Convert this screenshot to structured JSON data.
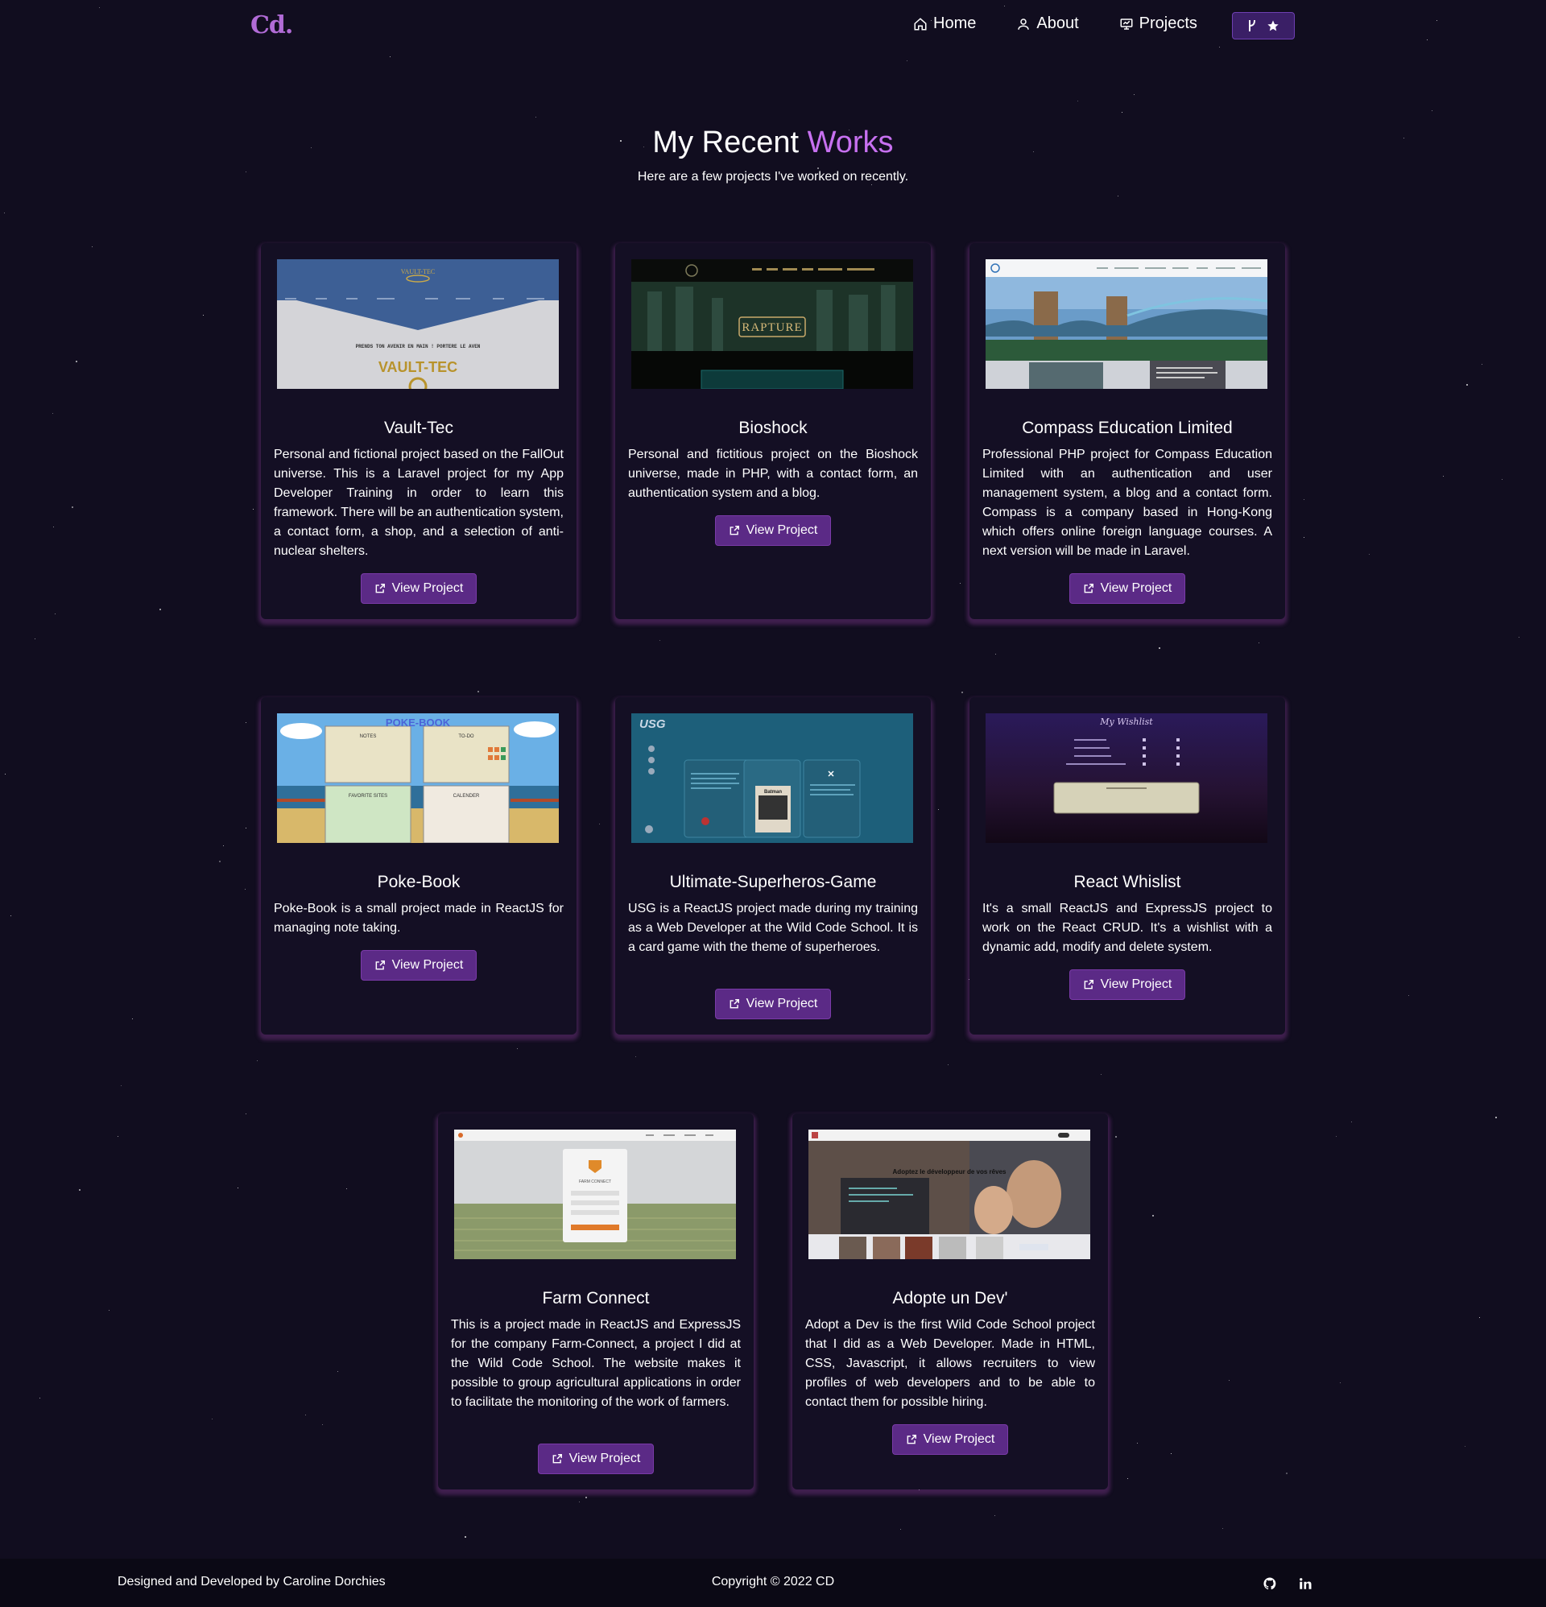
{
  "nav": {
    "logo": "Cd.",
    "links": [
      {
        "label": "Home",
        "icon": "home-icon"
      },
      {
        "label": "About",
        "icon": "user-icon"
      },
      {
        "label": "Projects",
        "icon": "presentation-icon"
      }
    ],
    "github_button_icons": [
      "fork-icon",
      "star-icon"
    ]
  },
  "heading": {
    "title_prefix": "My Recent ",
    "title_accent": "Works",
    "subtitle": "Here are a few projects I've worked on recently."
  },
  "projects": [
    {
      "title": "Vault-Tec",
      "description": "Personal and fictional project based on the FallOut universe. This is a Laravel project for my App Developer Training in order to learn this framework. There will be an authentication system, a contact form, a shop, and a selection of anti-nuclear shelters.",
      "button": "View Project",
      "screenshot_text": [
        "VAULT-TEC",
        "PRENDS TON AVENIR EN MAIN ! PORTERE LE AVEN"
      ]
    },
    {
      "title": "Bioshock",
      "description": "Personal and fictitious project on the Bioshock universe, made in PHP, with a contact form, an authentication system and a blog.",
      "button": "View Project",
      "screenshot_text": [
        "RAPTURE"
      ]
    },
    {
      "title": "Compass Education Limited",
      "description": "Professional PHP project for Compass Education Limited with an authentication and user management system, a blog and a contact form. Compass is a company based in Hong-Kong which offers online foreign language courses. A next version will be made in Laravel.",
      "button": "View Project",
      "screenshot_text": []
    },
    {
      "title": "Poke-Book",
      "description": "Poke-Book is a small project made in ReactJS for managing note taking.",
      "button": "View Project",
      "screenshot_text": [
        "POKE-BOOK",
        "NOTES",
        "TO-DO",
        "FAVORITE SITES",
        "CALENDER"
      ]
    },
    {
      "title": "Ultimate-Superheros-Game",
      "description": "USG is a ReactJS project made during my training as a Web Developer at the Wild Code School. It is a card game with the theme of superheroes.",
      "button": "View Project",
      "screenshot_text": [
        "USG",
        "Batman"
      ]
    },
    {
      "title": "React Whislist",
      "description": "It's a small ReactJS and ExpressJS project to work on the React CRUD. It's a wishlist with a dynamic add, modify and delete system.",
      "button": "View Project",
      "screenshot_text": [
        "My Wishlist"
      ]
    },
    {
      "title": "Farm Connect",
      "description": "This is a project made in ReactJS and ExpressJS for the company Farm-Connect, a project I did at the Wild Code School. The website makes it possible to group agricultural applications in order to facilitate the monitoring of the work of farmers.",
      "button": "View Project",
      "screenshot_text": [
        "FARM CONNECT"
      ]
    },
    {
      "title": "Adopte un Dev'",
      "description": "Adopt a Dev is the first Wild Code School project that I did as a Web Developer. Made in HTML, CSS, Javascript, it allows recruiters to view profiles of web developers and to be able to contact them for possible hiring.",
      "button": "View Project",
      "screenshot_text": [
        "Adoptez le développeur de vos rêves"
      ]
    }
  ],
  "footer": {
    "credit": "Designed and Developed by Caroline Dorchies",
    "copyright": "Copyright © 2022 CD",
    "social_icons": [
      "github-icon",
      "linkedin-icon"
    ]
  },
  "colors": {
    "background": "#110d1f",
    "accent": "#c770f0",
    "button": "#5b2a86",
    "logo": "#b16bd6"
  }
}
